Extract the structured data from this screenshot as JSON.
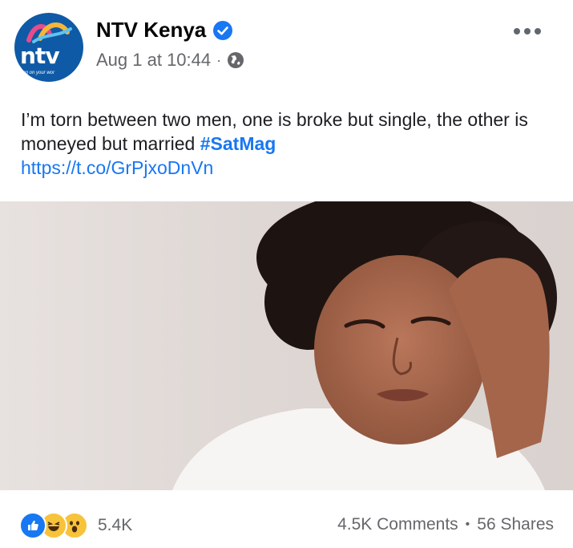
{
  "header": {
    "page_name": "NTV Kenya",
    "timestamp": "Aug 1 at 10:44",
    "separator": "·",
    "avatar": {
      "logo_text": "ntv",
      "tagline": "ming on your wor",
      "brand_color": "#0f5aa6"
    },
    "verified_icon": "verified-badge-icon",
    "audience_icon": "globe-icon",
    "more_icon": "more-options-icon"
  },
  "post": {
    "text": "I’m torn between two men, one is broke but single, the other is moneyed but married ",
    "hashtag": "#SatMag",
    "link": "https://t.co/GrPjxoDnVn"
  },
  "footer": {
    "reactions": [
      "like-icon",
      "haha-icon",
      "wow-icon"
    ],
    "reaction_count": "5.4K",
    "comments": "4.5K Comments",
    "separator": "•",
    "shares": "56 Shares"
  },
  "colors": {
    "link": "#1877f2",
    "muted": "#65676b",
    "text": "#1c1e21"
  }
}
